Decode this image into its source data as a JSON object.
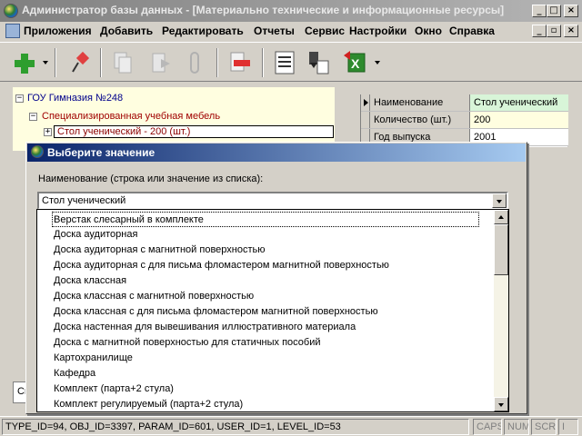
{
  "window": {
    "title": "Администратор базы данных - [Материально технические и информационные ресурсы]"
  },
  "menu": [
    "Приложения",
    "Добавить",
    "Редактировать",
    "Отчеты",
    "Сервис",
    "Настройки",
    "Окно",
    "Справка"
  ],
  "tree": {
    "root": "ГОУ Гимназия №248",
    "child": "Специализированная учебная мебель",
    "leaf": "Стол ученический - 200 (шт.)"
  },
  "grid": {
    "rows": [
      {
        "name": "Наименование",
        "value": "Стол ученический"
      },
      {
        "name": "Количество (шт.)",
        "value": "200"
      },
      {
        "name": "Год выпуска",
        "value": "2001"
      }
    ]
  },
  "bottom_panel": {
    "text": "Спец"
  },
  "dialog": {
    "title": "Выберите значение",
    "label": "Наименование (строка или значение из списка):",
    "combo_value": "Стол ученический",
    "options": [
      "Верстак слесарный в комплекте",
      "Доска аудиторная",
      "Доска аудиторная с магнитной поверхностью",
      "Доска аудиторная с для письма фломастером магнитной поверхностью",
      "Доска классная",
      "Доска классная с магнитной поверхностью",
      "Доска классная с для письма фломастером магнитной поверхностью",
      "Доска настенная для вывешивания иллюстративного материала",
      "Доска с магнитной поверхностью для статичных пособий",
      "Картохранилище",
      "Кафедра",
      "Комплект (парта+2 стула)",
      "Комплект регулируемый (парта+2 стула)"
    ]
  },
  "status": {
    "info": "TYPE_ID=94, OBJ_ID=3397, PARAM_ID=601, USER_ID=1, LEVEL_ID=53",
    "caps": "CAPS",
    "num": "NUM",
    "scrl": "SCRL",
    "ins": "I"
  }
}
